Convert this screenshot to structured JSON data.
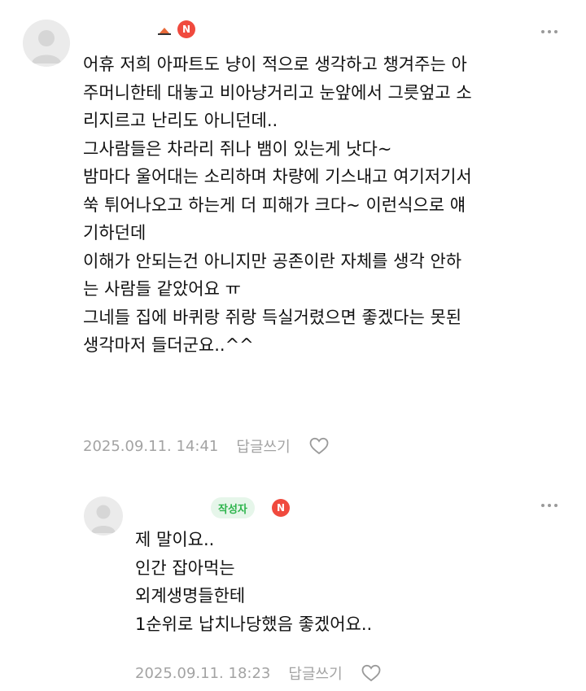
{
  "comments": [
    {
      "badge": "N",
      "lines": [
        "어휴 저희 아파트도 냥이 적으로 생각하고 챙겨주는 아",
        "주머니한테 대놓고 비아냥거리고 눈앞에서 그릇엎고 소",
        "리지르고 난리도 아니던데..",
        "그사람들은 차라리 쥐나 뱀이 있는게 낫다~",
        "밤마다 울어대는 소리하며 차량에 기스내고 여기저기서",
        "쑥 튀어나오고 하는게 더 피해가 크다~ 이런식으로 얘",
        "기하던데",
        "이해가 안되는건 아니지만 공존이란 자체를 생각 안하",
        "는 사람들 같았어요 ㅠ",
        "그네들 집에 바퀴랑 쥐랑 득실거렸으면 좋겠다는 못된",
        "생각마저 들더군요..^^"
      ],
      "timestamp": "2025.09.11. 14:41",
      "reply_label": "답글쓰기"
    },
    {
      "author_badge": "작성자",
      "badge": "N",
      "lines": [
        "제 말이요..",
        "인간 잡아먹는",
        "외계생명들한테",
        "1순위로 납치나당했음 좋겠어요.."
      ],
      "timestamp": "2025.09.11. 18:23",
      "reply_label": "답글쓰기"
    }
  ],
  "icons": [
    "avatar-placeholder-icon",
    "more-options-icon",
    "heart-icon",
    "new-badge-icon"
  ],
  "colors": {
    "new_badge": "#f04a3e",
    "author_badge_bg": "#e6f6ea",
    "author_badge_text": "#2db44c",
    "meta": "#a3a3a3"
  }
}
